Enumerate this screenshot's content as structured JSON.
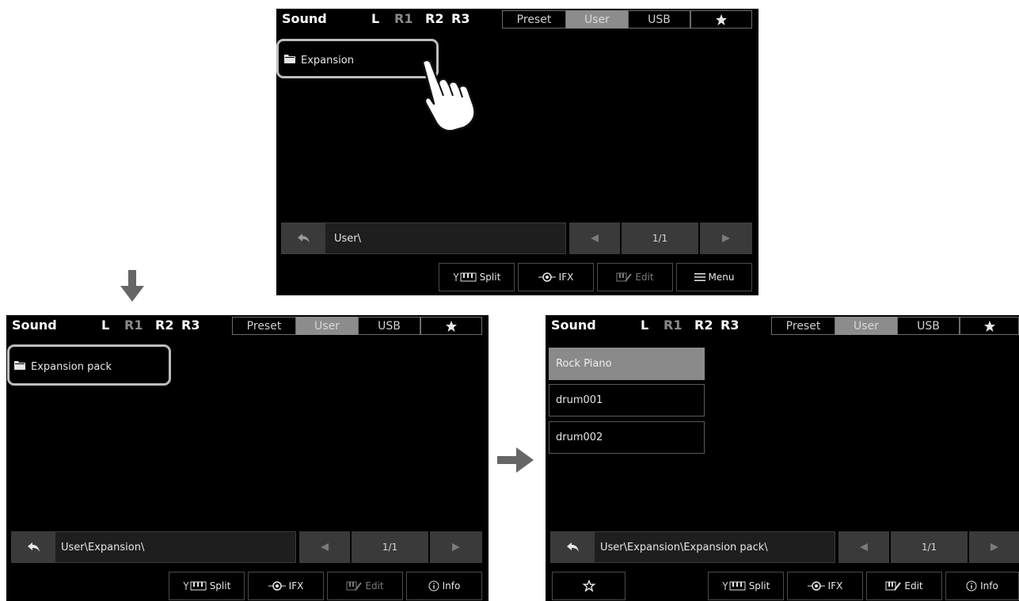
{
  "colors": {
    "screen_bg": "#000000",
    "active_tab": "#8c8c8c",
    "highlight_ring": "#bdbdbd",
    "button_bg": "#3a3a3a"
  },
  "screens": {
    "top": {
      "header": {
        "title": "Sound",
        "parts": [
          "L",
          "R1",
          "R2",
          "R3"
        ],
        "tabs": [
          "Preset",
          "User",
          "USB"
        ],
        "favorites_icon": "star-icon"
      },
      "folder_label": "Expansion",
      "path": "User\\",
      "page": "1/1",
      "buttons": {
        "split": "Split",
        "ifx": "IFX",
        "edit": "Edit",
        "menu": "Menu"
      }
    },
    "left": {
      "header": {
        "title": "Sound",
        "parts": [
          "L",
          "R1",
          "R2",
          "R3"
        ],
        "tabs": [
          "Preset",
          "User",
          "USB"
        ],
        "favorites_icon": "star-icon"
      },
      "folder_label": "Expansion pack",
      "path": "User\\Expansion\\",
      "page": "1/1",
      "buttons": {
        "split": "Split",
        "ifx": "IFX",
        "edit": "Edit",
        "info": "Info"
      }
    },
    "right": {
      "header": {
        "title": "Sound",
        "parts": [
          "L",
          "R1",
          "R2",
          "R3"
        ],
        "tabs": [
          "Preset",
          "User",
          "USB"
        ],
        "favorites_icon": "star-icon"
      },
      "items": [
        "Rock Piano",
        "drum001",
        "drum002"
      ],
      "path": "User\\Expansion\\Expansion pack\\",
      "page": "1/1",
      "buttons": {
        "split": "Split",
        "ifx": "IFX",
        "edit": "Edit",
        "info": "Info"
      }
    }
  }
}
